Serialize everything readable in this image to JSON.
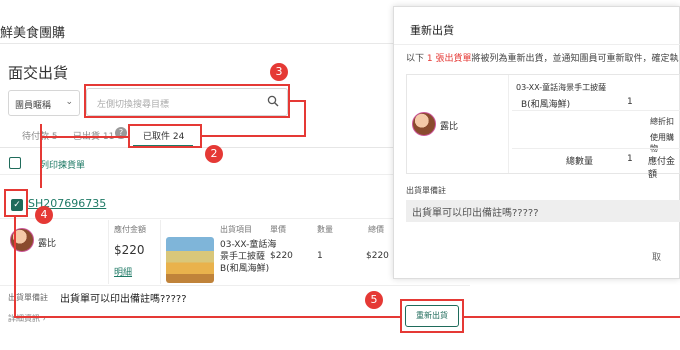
{
  "app": {
    "title": "鮮美食團購"
  },
  "page": {
    "title": "面交出貨"
  },
  "filter": {
    "select_value": "團員暱稱",
    "search_placeholder": "左側切換搜尋目標"
  },
  "tabs": [
    {
      "label": "待付款 5"
    },
    {
      "label": "已出貨 11"
    },
    {
      "label": "已取件 24"
    }
  ],
  "list": {
    "select_label": "列印揀貨單"
  },
  "order": {
    "id": "SH207696735",
    "customer": "露比",
    "amount_header": "應付金額",
    "amount": "$220",
    "details_link": "明細",
    "columns": [
      "出貨項目",
      "單價",
      "數量",
      "總價"
    ],
    "item_name": "03-XX-童話海景手工披薩B(和風海鮮)",
    "unit_price": "$220",
    "qty": "1",
    "total": "$220",
    "remark_label": "出貨單備註",
    "remark": "出貨單可以印出備註嗎?????",
    "detail_info_link": "詳細資訊",
    "reship_button": "重新出貨"
  },
  "modal": {
    "title": "重新出貨",
    "desc_prefix": "以下",
    "desc_highlight": "1 張出貨單",
    "desc_suffix": "將被列為重新出貨，並通知團員可重新取件，確定執",
    "customer": "露比",
    "item_line1": "03-XX-童話海景手工披薩",
    "item_line2": "B(和風海鮮)",
    "item_qty": "1",
    "discount_label": "總折扣",
    "credit_label": "使用購物",
    "total_qty_label": "總數量",
    "total_qty": "1",
    "due_label": "應付金額",
    "remark_label": "出貨單備註",
    "remark": "出貨單可以印出備註嗎?????",
    "cancel_label": "取"
  },
  "steps": [
    "2",
    "3",
    "4",
    "5"
  ],
  "colors": {
    "accent": "#1f6b5b",
    "annotation": "#e53935"
  }
}
